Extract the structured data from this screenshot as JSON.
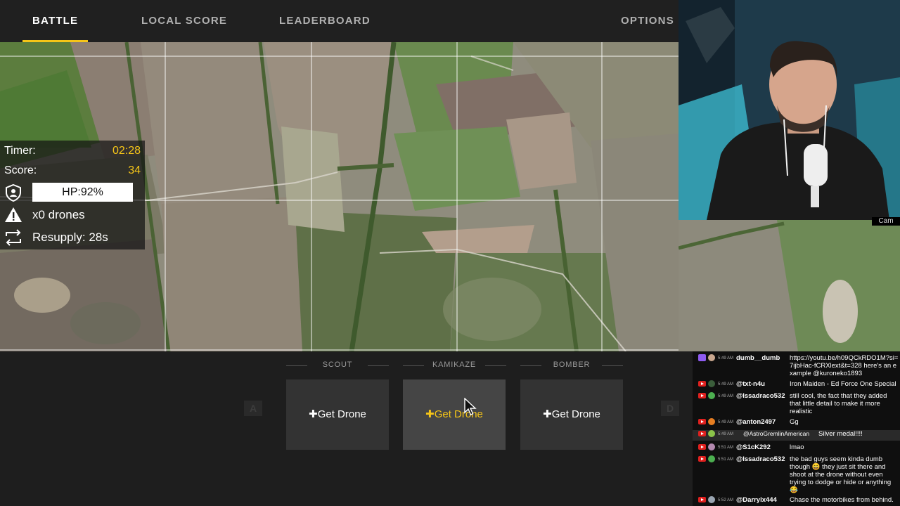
{
  "nav": {
    "tabs": [
      {
        "label": "BATTLE",
        "active": true
      },
      {
        "label": "LOCAL SCORE",
        "active": false
      },
      {
        "label": "LEADERBOARD",
        "active": false
      }
    ],
    "options_label": "OPTIONS"
  },
  "hud": {
    "timer_label": "Timer:",
    "timer_value": "02:28",
    "score_label": "Score:",
    "score_value": "34",
    "hp_text": "HP:92%",
    "drones_text": "x0 drones",
    "resupply_text": "Resupply: 28s",
    "accent_color": "#f5c518"
  },
  "drone_slots": [
    {
      "label": "SCOUT",
      "button": "Get Drone"
    },
    {
      "label": "KAMIKAZE",
      "button": "Get Drone"
    },
    {
      "label": "BOMBER",
      "button": "Get Drone"
    }
  ],
  "key_hints": {
    "left": "A",
    "right": "D"
  },
  "stream": {
    "cam_label": "Cam",
    "chat": [
      {
        "platform": "twitch",
        "time": "5:49 AM",
        "user": "dumb__dumb",
        "message": "https://youtu.be/h09QCkRDO1M?si=7ijbHac-fCRXlext&t=328 here's an example @kuroneko1893"
      },
      {
        "platform": "youtube",
        "time": "5:49 AM",
        "user": "@txt-n4u",
        "message": "Iron Maiden - Ed Force One Special"
      },
      {
        "platform": "youtube",
        "time": "5:49 AM",
        "user": "@lssadraco532",
        "message": "still cool, the fact that they added that little detail to make it more realistic"
      },
      {
        "platform": "youtube",
        "time": "5:49 AM",
        "user": "@anton2497",
        "message": "Gg"
      },
      {
        "platform": "youtube",
        "time": "5:49 AM",
        "user": "@AstroGremlinAmerican",
        "message": "Silver medal!!!!"
      },
      {
        "platform": "youtube",
        "time": "5:51 AM",
        "user": "@S1cK292",
        "message": "lmao"
      },
      {
        "platform": "youtube",
        "time": "5:51 AM",
        "user": "@lssadraco532",
        "message": "the bad guys seem kinda dumb though 😄 they just sit there and shoot at the drone without even trying to dodge or hide or anything 😂"
      },
      {
        "platform": "youtube",
        "time": "5:52 AM",
        "user": "@Darrylx444",
        "message": "Chase the motorbikes from behind."
      }
    ]
  }
}
